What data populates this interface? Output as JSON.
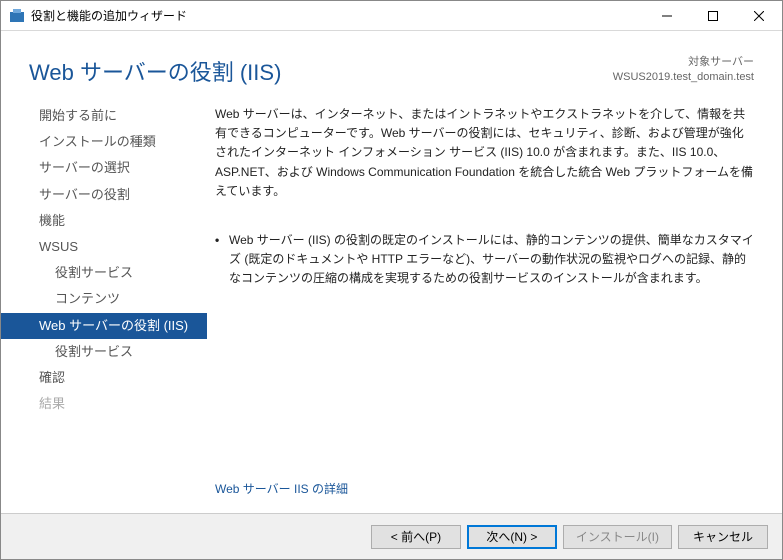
{
  "titlebar": {
    "title": "役割と機能の追加ウィザード"
  },
  "header": {
    "page_title": "Web サーバーの役割 (IIS)",
    "server_label": "対象サーバー",
    "server_name": "WSUS2019.test_domain.test"
  },
  "sidebar": {
    "items": [
      {
        "label": "開始する前に",
        "indent": false,
        "selected": false,
        "disabled": false
      },
      {
        "label": "インストールの種類",
        "indent": false,
        "selected": false,
        "disabled": false
      },
      {
        "label": "サーバーの選択",
        "indent": false,
        "selected": false,
        "disabled": false
      },
      {
        "label": "サーバーの役割",
        "indent": false,
        "selected": false,
        "disabled": false
      },
      {
        "label": "機能",
        "indent": false,
        "selected": false,
        "disabled": false
      },
      {
        "label": "WSUS",
        "indent": false,
        "selected": false,
        "disabled": false
      },
      {
        "label": "役割サービス",
        "indent": true,
        "selected": false,
        "disabled": false
      },
      {
        "label": "コンテンツ",
        "indent": true,
        "selected": false,
        "disabled": false
      },
      {
        "label": "Web サーバーの役割 (IIS)",
        "indent": false,
        "selected": true,
        "disabled": false
      },
      {
        "label": "役割サービス",
        "indent": true,
        "selected": false,
        "disabled": false
      },
      {
        "label": "確認",
        "indent": false,
        "selected": false,
        "disabled": false
      },
      {
        "label": "結果",
        "indent": false,
        "selected": false,
        "disabled": true
      }
    ]
  },
  "body": {
    "description": "Web サーバーは、インターネット、またはイントラネットやエクストラネットを介して、情報を共有できるコンピューターです。Web サーバーの役割には、セキュリティ、診断、および管理が強化されたインターネット インフォメーション サービス (IIS) 10.0 が含まれます。また、IIS 10.0、ASP.NET、および Windows Communication Foundation を統合した統合 Web プラットフォームを備えています。",
    "bullets": [
      "Web サーバー (IIS) の役割の既定のインストールには、静的コンテンツの提供、簡単なカスタマイズ (既定のドキュメントや HTTP エラーなど)、サーバーの動作状況の監視やログへの記録、静的なコンテンツの圧縮の構成を実現するための役割サービスのインストールが含まれます。"
    ],
    "more_link": "Web サーバー IIS の詳細"
  },
  "buttons": {
    "prev": "< 前へ(P)",
    "next": "次へ(N) >",
    "install": "インストール(I)",
    "cancel": "キャンセル"
  }
}
